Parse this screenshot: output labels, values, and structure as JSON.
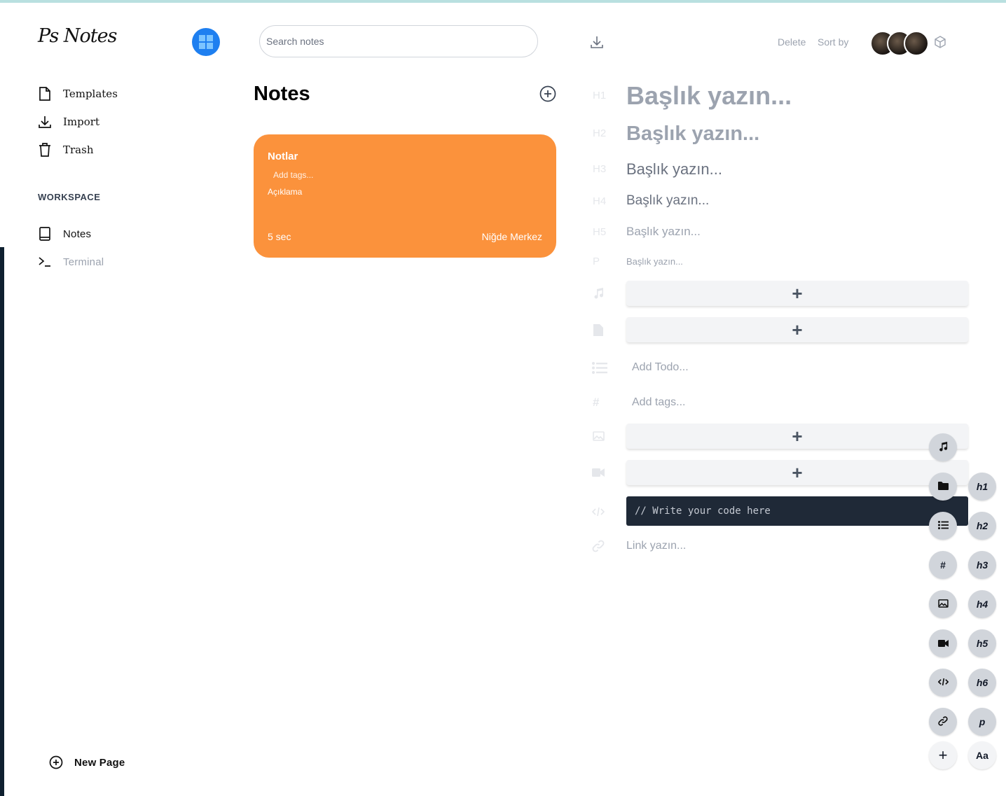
{
  "app": {
    "logo_text": "Ps Notes",
    "brand_color": "#1e7ff0"
  },
  "sidebar": {
    "items": [
      {
        "label": "Templates",
        "icon": "file-icon"
      },
      {
        "label": "Import",
        "icon": "download-icon"
      },
      {
        "label": "Trash",
        "icon": "trash-icon"
      }
    ],
    "workspace_label": "WORKSPACE",
    "workspace_items": [
      {
        "label": "Notes",
        "icon": "book-icon"
      },
      {
        "label": "Terminal",
        "icon": "terminal-icon"
      }
    ],
    "new_page_label": "New Page"
  },
  "header": {
    "search_placeholder": "Search notes",
    "delete_label": "Delete",
    "sort_label": "Sort by"
  },
  "notes": {
    "title": "Notes",
    "cards": [
      {
        "title": "Notlar",
        "tags_placeholder": "Add tags...",
        "description": "Açıklama",
        "time": "5 sec",
        "location": "Niğde Merkez",
        "color": "#fb923c"
      }
    ]
  },
  "editor": {
    "headings": [
      {
        "tag": "H1",
        "placeholder": "Başlık yazın..."
      },
      {
        "tag": "H2",
        "placeholder": "Başlık yazın..."
      },
      {
        "tag": "H3",
        "placeholder": "Başlık yazın..."
      },
      {
        "tag": "H4",
        "placeholder": "Başlık yazın..."
      },
      {
        "tag": "H5",
        "placeholder": "Başlık yazın..."
      },
      {
        "tag": "P",
        "placeholder": "Başlık yazın..."
      }
    ],
    "add_symbol": "+",
    "todo_placeholder": "Add Todo...",
    "tags_placeholder": "Add tags...",
    "code_placeholder": "// Write your code here",
    "link_placeholder": "Link yazın...",
    "code_bg": "#1f2937"
  },
  "toolbar": {
    "left_buttons": [
      "music-icon",
      "folder-icon",
      "list-icon",
      "#",
      "image-icon",
      "video-icon",
      "code-icon",
      "link-icon",
      "+"
    ],
    "right_buttons": [
      "h1",
      "h2",
      "h3",
      "h4",
      "h5",
      "h6",
      "p",
      "Aa"
    ]
  }
}
